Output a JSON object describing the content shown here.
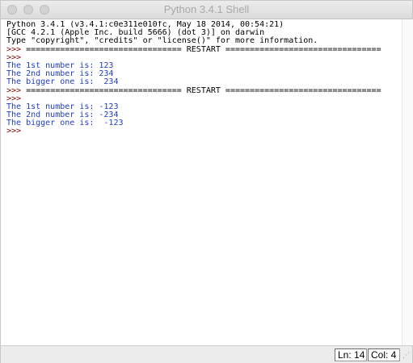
{
  "window": {
    "title": "Python 3.4.1 Shell"
  },
  "shell": {
    "lines": [
      {
        "text": "Python 3.4.1 (v3.4.1:c0e311e010fc, May 18 2014, 00:54:21)",
        "kind": "plain"
      },
      {
        "text": "[GCC 4.2.1 (Apple Inc. build 5666) (dot 3)] on darwin",
        "kind": "plain"
      },
      {
        "text": "Type \"copyright\", \"credits\" or \"license()\" for more information.",
        "kind": "plain"
      },
      {
        "prompt": ">>> ",
        "text": "================================ RESTART ================================",
        "kind": "prompt"
      },
      {
        "prompt": ">>> ",
        "text": "",
        "kind": "prompt"
      },
      {
        "text": "The 1st number is: 123",
        "kind": "out"
      },
      {
        "text": "The 2nd number is: 234",
        "kind": "out"
      },
      {
        "text": "The bigger one is:  234",
        "kind": "out"
      },
      {
        "prompt": ">>> ",
        "text": "================================ RESTART ================================",
        "kind": "prompt"
      },
      {
        "prompt": ">>> ",
        "text": "",
        "kind": "prompt"
      },
      {
        "text": "The 1st number is: -123",
        "kind": "out"
      },
      {
        "text": "The 2nd number is: -234",
        "kind": "out"
      },
      {
        "text": "The bigger one is:  -123",
        "kind": "out"
      },
      {
        "prompt": ">>> ",
        "text": "",
        "kind": "prompt"
      }
    ]
  },
  "statusbar": {
    "ln": "Ln: 14",
    "col": "Col: 4"
  },
  "colors": {
    "prompt": "#8b0000",
    "output": "#1f3cc6",
    "text": "#000000"
  }
}
